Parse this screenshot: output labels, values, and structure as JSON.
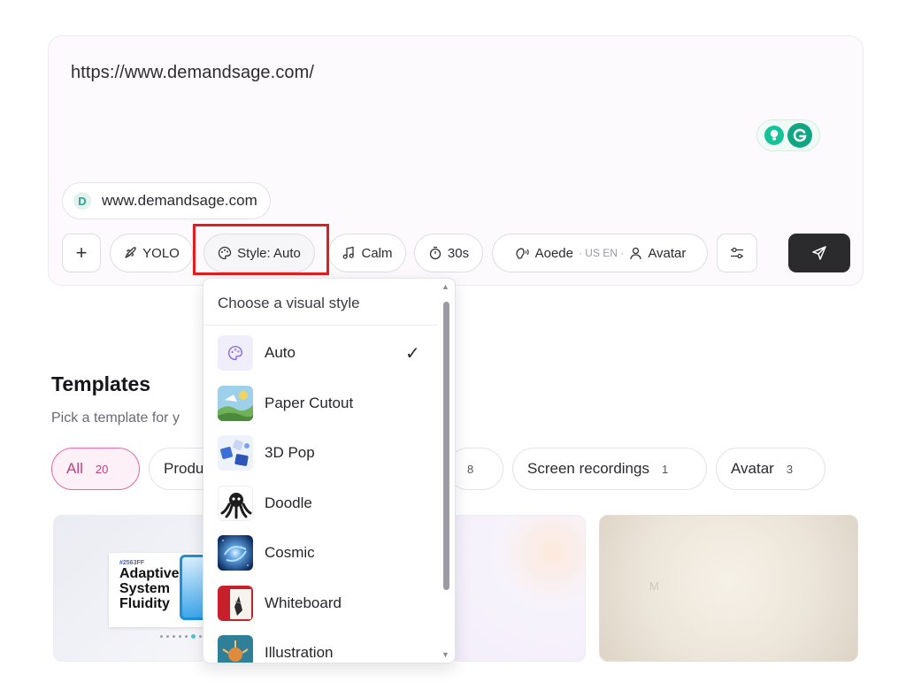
{
  "prompt": {
    "text": "https://www.demandsage.com/",
    "source_chip": {
      "favicon_letter": "D",
      "label": "www.demandsage.com"
    }
  },
  "toolbar": {
    "add_label": "+",
    "yolo_label": "YOLO",
    "style_label": "Style: Auto",
    "music_label": "Calm",
    "duration_label": "30s",
    "voice_label": "Aoede",
    "voice_locale": "· US EN ·",
    "avatar_label": "Avatar"
  },
  "style_menu": {
    "header": "Choose a visual style",
    "selected": "Auto",
    "items": [
      {
        "label": "Auto",
        "icon": "palette-icon"
      },
      {
        "label": "Paper Cutout",
        "icon": "paper-cutout-thumb"
      },
      {
        "label": "3D Pop",
        "icon": "3d-pop-thumb"
      },
      {
        "label": "Doodle",
        "icon": "doodle-thumb"
      },
      {
        "label": "Cosmic",
        "icon": "cosmic-thumb"
      },
      {
        "label": "Whiteboard",
        "icon": "whiteboard-thumb"
      },
      {
        "label": "Illustration",
        "icon": "illustration-thumb"
      }
    ]
  },
  "templates": {
    "title": "Templates",
    "subtitle": "Pick a template for y",
    "filters": [
      {
        "label": "All",
        "count": "20",
        "selected": true
      },
      {
        "label": "Produ",
        "count": ""
      },
      {
        "label": "",
        "count": "8"
      },
      {
        "label": "Screen recordings",
        "count": "1"
      },
      {
        "label": "Avatar",
        "count": "3"
      }
    ],
    "card1": {
      "code": "#2563FF",
      "headline_1": "Adaptive D",
      "headline_2": "System",
      "headline_3": "Fluidity"
    },
    "card3": {
      "mark": "M"
    }
  },
  "colors": {
    "highlight": "#e31d1d",
    "accent_pink": "#c23f80",
    "send_button": "#2b2b2e",
    "grammarly": "#15c39a"
  }
}
